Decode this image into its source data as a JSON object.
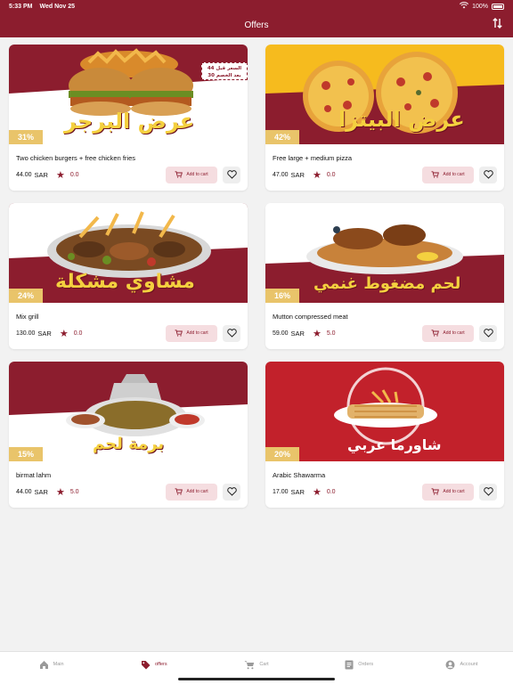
{
  "status": {
    "time": "5:33 PM",
    "date": "Wed Nov 25",
    "battery": "100%"
  },
  "header": {
    "title": "Offers",
    "sort_icon": "sort-arrows-icon"
  },
  "colors": {
    "brand": "#8c1d2e",
    "badge": "#e9c46a",
    "star": "#8c1d2e"
  },
  "offers": [
    {
      "name": "Two chicken burgers + free chicken fries",
      "price": "44.00",
      "currency": "SAR",
      "rating": "0.0",
      "discount": "31%",
      "banner_text": "عرض البرجر",
      "sticker_line1": "السعر قبل 44",
      "sticker_line2": "بعد الخصم 30",
      "add_label": "Add to cart"
    },
    {
      "name": "Free large + medium pizza",
      "price": "47.00",
      "currency": "SAR",
      "rating": "0.0",
      "discount": "42%",
      "banner_text": "عرض البيتزا",
      "add_label": "Add to cart"
    },
    {
      "name": "Mix grill",
      "price": "130.00",
      "currency": "SAR",
      "rating": "0.0",
      "discount": "24%",
      "banner_text": "مشاوي مشكلة",
      "add_label": "Add to cart"
    },
    {
      "name": "Mutton compressed meat",
      "price": "59.00",
      "currency": "SAR",
      "rating": "5.0",
      "discount": "16%",
      "banner_text": "لحم مضغوط غنمي",
      "add_label": "Add to cart"
    },
    {
      "name": "birmat lahm",
      "price": "44.00",
      "currency": "SAR",
      "rating": "5.0",
      "discount": "15%",
      "banner_text": "برمة لحم",
      "add_label": "Add to cart"
    },
    {
      "name": "Arabic Shawarma",
      "price": "17.00",
      "currency": "SAR",
      "rating": "0.0",
      "discount": "20%",
      "banner_text": "شاورما عربي",
      "add_label": "Add to cart"
    }
  ],
  "tabs": [
    {
      "label": "Main",
      "icon": "home-icon",
      "active": false
    },
    {
      "label": "offers",
      "icon": "tag-icon",
      "active": true
    },
    {
      "label": "Cart",
      "icon": "cart-icon",
      "active": false
    },
    {
      "label": "Orders",
      "icon": "orders-icon",
      "active": false
    },
    {
      "label": "Account",
      "icon": "account-icon",
      "active": false
    }
  ]
}
